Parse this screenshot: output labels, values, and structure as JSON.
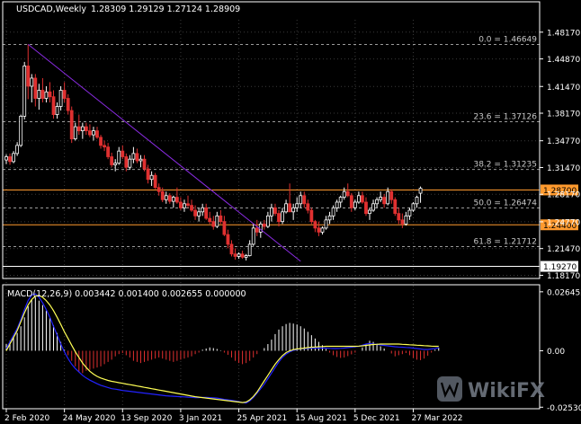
{
  "chart_data": {
    "type": "candlestick",
    "symbol_label": "USDCAD,Weekly",
    "ohlc_label": "1.28309 1.29129 1.27124 1.28909",
    "price_axis": {
      "ticks": [
        "1.48170",
        "1.44870",
        "1.41470",
        "1.38170",
        "1.34770",
        "1.31470",
        "1.28170",
        "1.24770",
        "1.21470",
        "1.18170"
      ],
      "ylim": [
        1.18,
        1.497
      ]
    },
    "date_axis": [
      "2 Feb 2020",
      "24 May 2020",
      "13 Sep 2020",
      "3 Jan 2021",
      "25 Apr 2021",
      "15 Aug 2021",
      "5 Dec 2021",
      "27 Mar 2022"
    ],
    "fibonacci": [
      {
        "label": "0.0 = 1.46649",
        "price": 1.46649
      },
      {
        "label": "23.6 = 1.37126",
        "price": 1.37126
      },
      {
        "label": "38.2 = 1.31235",
        "price": 1.31235
      },
      {
        "label": "50.0 = 1.26474",
        "price": 1.26474
      },
      {
        "label": "61.8 = 1.21712",
        "price": 1.21712
      }
    ],
    "levels": [
      {
        "label": "1.28700",
        "price": 1.287,
        "color": "#ff9a2e"
      },
      {
        "label": "1.24400",
        "price": 1.244,
        "color": "#ff9a2e"
      },
      {
        "label": "1.19270",
        "price": 1.1927,
        "color": "#ffffff"
      }
    ],
    "trendline": {
      "from": {
        "date": "16 Mar 2020",
        "price": 1.4667
      },
      "to": {
        "date": "19 Sep 2021",
        "price": 1.199
      },
      "color": "#8a2be2"
    },
    "candles": [
      [
        1.324,
        1.331,
        1.319,
        1.328
      ],
      [
        1.328,
        1.332,
        1.318,
        1.322
      ],
      [
        1.322,
        1.335,
        1.32,
        1.332
      ],
      [
        1.332,
        1.346,
        1.329,
        1.342
      ],
      [
        1.342,
        1.38,
        1.34,
        1.378
      ],
      [
        1.378,
        1.445,
        1.374,
        1.44
      ],
      [
        1.44,
        1.4667,
        1.399,
        1.415
      ],
      [
        1.415,
        1.43,
        1.395,
        1.425
      ],
      [
        1.425,
        1.43,
        1.39,
        1.4
      ],
      [
        1.4,
        1.418,
        1.386,
        1.41
      ],
      [
        1.41,
        1.425,
        1.395,
        1.4
      ],
      [
        1.4,
        1.415,
        1.395,
        1.408
      ],
      [
        1.408,
        1.42,
        1.395,
        1.402
      ],
      [
        1.402,
        1.41,
        1.375,
        1.38
      ],
      [
        1.38,
        1.395,
        1.375,
        1.39
      ],
      [
        1.39,
        1.415,
        1.385,
        1.41
      ],
      [
        1.41,
        1.42,
        1.395,
        1.4
      ],
      [
        1.4,
        1.405,
        1.38,
        1.385
      ],
      [
        1.385,
        1.39,
        1.345,
        1.35
      ],
      [
        1.35,
        1.37,
        1.348,
        1.365
      ],
      [
        1.365,
        1.38,
        1.355,
        1.36
      ],
      [
        1.36,
        1.37,
        1.35,
        1.365
      ],
      [
        1.365,
        1.37,
        1.355,
        1.36
      ],
      [
        1.36,
        1.368,
        1.352,
        1.355
      ],
      [
        1.355,
        1.365,
        1.348,
        1.36
      ],
      [
        1.36,
        1.365,
        1.35,
        1.352
      ],
      [
        1.352,
        1.355,
        1.338,
        1.342
      ],
      [
        1.342,
        1.348,
        1.335,
        1.34
      ],
      [
        1.34,
        1.345,
        1.325,
        1.328
      ],
      [
        1.328,
        1.333,
        1.315,
        1.318
      ],
      [
        1.318,
        1.325,
        1.31,
        1.32
      ],
      [
        1.32,
        1.34,
        1.318,
        1.335
      ],
      [
        1.335,
        1.342,
        1.325,
        1.328
      ],
      [
        1.328,
        1.332,
        1.31,
        1.315
      ],
      [
        1.315,
        1.33,
        1.312,
        1.325
      ],
      [
        1.325,
        1.34,
        1.32,
        1.332
      ],
      [
        1.332,
        1.338,
        1.32,
        1.323
      ],
      [
        1.323,
        1.33,
        1.315,
        1.325
      ],
      [
        1.325,
        1.33,
        1.31,
        1.313
      ],
      [
        1.313,
        1.318,
        1.295,
        1.3
      ],
      [
        1.3,
        1.31,
        1.292,
        1.305
      ],
      [
        1.305,
        1.308,
        1.288,
        1.29
      ],
      [
        1.29,
        1.295,
        1.28,
        1.285
      ],
      [
        1.285,
        1.29,
        1.272,
        1.275
      ],
      [
        1.275,
        1.285,
        1.27,
        1.28
      ],
      [
        1.28,
        1.283,
        1.27,
        1.273
      ],
      [
        1.273,
        1.28,
        1.265,
        1.278
      ],
      [
        1.278,
        1.29,
        1.27,
        1.272
      ],
      [
        1.272,
        1.278,
        1.262,
        1.265
      ],
      [
        1.265,
        1.275,
        1.26,
        1.27
      ],
      [
        1.27,
        1.28,
        1.265,
        1.268
      ],
      [
        1.268,
        1.275,
        1.26,
        1.262
      ],
      [
        1.262,
        1.268,
        1.25,
        1.255
      ],
      [
        1.255,
        1.265,
        1.248,
        1.26
      ],
      [
        1.26,
        1.27,
        1.255,
        1.265
      ],
      [
        1.265,
        1.27,
        1.25,
        1.252
      ],
      [
        1.252,
        1.26,
        1.245,
        1.248
      ],
      [
        1.248,
        1.255,
        1.238,
        1.242
      ],
      [
        1.242,
        1.26,
        1.24,
        1.255
      ],
      [
        1.255,
        1.262,
        1.245,
        1.248
      ],
      [
        1.248,
        1.255,
        1.23,
        1.232
      ],
      [
        1.232,
        1.238,
        1.215,
        1.22
      ],
      [
        1.22,
        1.225,
        1.205,
        1.208
      ],
      [
        1.208,
        1.215,
        1.201,
        1.205
      ],
      [
        1.205,
        1.21,
        1.202,
        1.208
      ],
      [
        1.208,
        1.212,
        1.202,
        1.204
      ],
      [
        1.204,
        1.208,
        1.2,
        1.206
      ],
      [
        1.206,
        1.225,
        1.205,
        1.22
      ],
      [
        1.22,
        1.245,
        1.218,
        1.24
      ],
      [
        1.24,
        1.25,
        1.23,
        1.235
      ],
      [
        1.235,
        1.248,
        1.228,
        1.245
      ],
      [
        1.245,
        1.25,
        1.238,
        1.242
      ],
      [
        1.242,
        1.26,
        1.24,
        1.255
      ],
      [
        1.255,
        1.27,
        1.248,
        1.265
      ],
      [
        1.265,
        1.27,
        1.255,
        1.258
      ],
      [
        1.258,
        1.262,
        1.242,
        1.248
      ],
      [
        1.248,
        1.265,
        1.245,
        1.26
      ],
      [
        1.26,
        1.275,
        1.258,
        1.27
      ],
      [
        1.27,
        1.295,
        1.265,
        1.26
      ],
      [
        1.26,
        1.27,
        1.25,
        1.265
      ],
      [
        1.265,
        1.278,
        1.26,
        1.27
      ],
      [
        1.27,
        1.285,
        1.265,
        1.28
      ],
      [
        1.28,
        1.285,
        1.265,
        1.27
      ],
      [
        1.27,
        1.275,
        1.258,
        1.262
      ],
      [
        1.262,
        1.265,
        1.245,
        1.248
      ],
      [
        1.248,
        1.25,
        1.235,
        1.24
      ],
      [
        1.24,
        1.248,
        1.23,
        1.235
      ],
      [
        1.235,
        1.242,
        1.232,
        1.24
      ],
      [
        1.24,
        1.255,
        1.238,
        1.25
      ],
      [
        1.25,
        1.26,
        1.245,
        1.255
      ],
      [
        1.255,
        1.268,
        1.25,
        1.265
      ],
      [
        1.265,
        1.275,
        1.26,
        1.272
      ],
      [
        1.272,
        1.28,
        1.265,
        1.278
      ],
      [
        1.278,
        1.29,
        1.275,
        1.285
      ],
      [
        1.285,
        1.295,
        1.278,
        1.28
      ],
      [
        1.28,
        1.283,
        1.26,
        1.265
      ],
      [
        1.265,
        1.275,
        1.262,
        1.272
      ],
      [
        1.272,
        1.285,
        1.27,
        1.28
      ],
      [
        1.28,
        1.285,
        1.27,
        1.272
      ],
      [
        1.272,
        1.278,
        1.255,
        1.258
      ],
      [
        1.258,
        1.265,
        1.25,
        1.262
      ],
      [
        1.262,
        1.275,
        1.26,
        1.27
      ],
      [
        1.27,
        1.278,
        1.265,
        1.275
      ],
      [
        1.275,
        1.285,
        1.272,
        1.278
      ],
      [
        1.278,
        1.282,
        1.265,
        1.27
      ],
      [
        1.27,
        1.29,
        1.268,
        1.285
      ],
      [
        1.285,
        1.288,
        1.27,
        1.275
      ],
      [
        1.275,
        1.278,
        1.255,
        1.258
      ],
      [
        1.258,
        1.265,
        1.245,
        1.25
      ],
      [
        1.25,
        1.258,
        1.24,
        1.245
      ],
      [
        1.245,
        1.26,
        1.243,
        1.255
      ],
      [
        1.255,
        1.265,
        1.25,
        1.262
      ],
      [
        1.262,
        1.272,
        1.26,
        1.27
      ],
      [
        1.27,
        1.28,
        1.265,
        1.278
      ],
      [
        1.283,
        1.2913,
        1.2712,
        1.2891
      ]
    ],
    "macd": {
      "label": "MACD(12,26,9) 0.003442 0.001400 0.002655 0.000000",
      "ticks": [
        "0.026452",
        "0.00",
        "-0.025307"
      ],
      "ylim": [
        -0.026,
        0.028
      ],
      "colors": {
        "hist_up": "#ffffff",
        "hist_down": "#e03030",
        "main": "#2222ff",
        "signal": "#ffff55"
      },
      "hist": [
        0.003,
        0.0045,
        0.006,
        0.008,
        0.011,
        0.015,
        0.02,
        0.023,
        0.024,
        0.0225,
        0.0205,
        0.018,
        0.015,
        0.0115,
        0.008,
        0.004,
        0.0005,
        -0.002,
        -0.0045,
        -0.007,
        -0.0095,
        -0.01,
        -0.009,
        -0.0085,
        -0.008,
        -0.0075,
        -0.007,
        -0.006,
        -0.005,
        -0.004,
        -0.0025,
        -0.0015,
        -0.001,
        -0.002,
        -0.003,
        -0.0045,
        -0.005,
        -0.0055,
        -0.005,
        -0.0045,
        -0.004,
        -0.0035,
        -0.003,
        -0.0035,
        -0.004,
        -0.0045,
        -0.005,
        -0.0045,
        -0.004,
        -0.0035,
        -0.003,
        -0.0025,
        -0.0015,
        -0.0008,
        0.0005,
        0.001,
        0.0015,
        0.0012,
        0.0008,
        0.0002,
        -0.0008,
        -0.0018,
        -0.003,
        -0.0045,
        -0.0055,
        -0.006,
        -0.0055,
        -0.0045,
        -0.003,
        -0.0015,
        0.0,
        0.0012,
        0.003,
        0.005,
        0.0075,
        0.0095,
        0.011,
        0.012,
        0.0125,
        0.0122,
        0.0118,
        0.011,
        0.01,
        0.0085,
        0.007,
        0.0055,
        0.004,
        0.0025,
        0.0008,
        -0.0008,
        -0.002,
        -0.0028,
        -0.0032,
        -0.003,
        -0.0024,
        -0.0016,
        -0.0008,
        0.0,
        0.0015,
        0.003,
        0.0045,
        0.004,
        0.0032,
        0.002,
        0.001,
        0.0,
        -0.0012,
        -0.0025,
        -0.002,
        -0.0015,
        -0.001,
        -0.002,
        -0.0032,
        -0.004,
        -0.0042,
        -0.0035,
        -0.0022,
        -0.0008,
        0.0005,
        0.0014
      ],
      "main": [
        0.001,
        0.004,
        0.007,
        0.01,
        0.014,
        0.0185,
        0.0225,
        0.025,
        0.0255,
        0.024,
        0.0215,
        0.0185,
        0.015,
        0.011,
        0.007,
        0.003,
        -0.0005,
        -0.0035,
        -0.006,
        -0.008,
        -0.0095,
        -0.011,
        -0.0122,
        -0.0132,
        -0.014,
        -0.0148,
        -0.0155,
        -0.016,
        -0.0165,
        -0.017,
        -0.0172,
        -0.0175,
        -0.0178,
        -0.018,
        -0.0182,
        -0.0184,
        -0.0186,
        -0.0188,
        -0.019,
        -0.0192,
        -0.0194,
        -0.0196,
        -0.0198,
        -0.02,
        -0.0202,
        -0.0203,
        -0.0204,
        -0.0205,
        -0.0206,
        -0.0207,
        -0.0208,
        -0.0209,
        -0.021,
        -0.021,
        -0.0209,
        -0.0209,
        -0.021,
        -0.0211,
        -0.0212,
        -0.0215,
        -0.0218,
        -0.022,
        -0.0222,
        -0.0225,
        -0.0228,
        -0.0232,
        -0.0235,
        -0.0225,
        -0.021,
        -0.019,
        -0.017,
        -0.015,
        -0.0125,
        -0.01,
        -0.0075,
        -0.005,
        -0.003,
        -0.0015,
        -0.0005,
        0.0002,
        0.0006,
        0.0009,
        0.001,
        0.0011,
        0.0012,
        0.0012,
        0.0012,
        0.0012,
        0.0012,
        0.0011,
        0.001,
        0.001,
        0.0011,
        0.0012,
        0.0014,
        0.0016,
        0.0018,
        0.002,
        0.0025,
        0.003,
        0.0032,
        0.003,
        0.0028,
        0.0026,
        0.0024,
        0.0022,
        0.002,
        0.0018,
        0.0017,
        0.0016,
        0.0015,
        0.0014,
        0.0012,
        0.001,
        0.0008,
        0.0006,
        0.0006,
        0.0008,
        0.001,
        0.0014
      ],
      "signal": [
        0.0,
        0.003,
        0.006,
        0.009,
        0.013,
        0.017,
        0.0205,
        0.023,
        0.0245,
        0.0248,
        0.024,
        0.0225,
        0.0205,
        0.018,
        0.015,
        0.0118,
        0.0085,
        0.0055,
        0.0025,
        -0.0005,
        -0.003,
        -0.0055,
        -0.0075,
        -0.0092,
        -0.0105,
        -0.0115,
        -0.0122,
        -0.0128,
        -0.0133,
        -0.0137,
        -0.014,
        -0.0143,
        -0.0146,
        -0.0149,
        -0.0152,
        -0.0155,
        -0.0158,
        -0.0161,
        -0.0164,
        -0.0167,
        -0.017,
        -0.0173,
        -0.0176,
        -0.0179,
        -0.0182,
        -0.0185,
        -0.0188,
        -0.0191,
        -0.0194,
        -0.0197,
        -0.02,
        -0.0203,
        -0.0206,
        -0.0208,
        -0.021,
        -0.0212,
        -0.0214,
        -0.0216,
        -0.0218,
        -0.022,
        -0.0222,
        -0.0224,
        -0.0226,
        -0.0228,
        -0.023,
        -0.0232,
        -0.023,
        -0.022,
        -0.0205,
        -0.0185,
        -0.016,
        -0.0135,
        -0.011,
        -0.0085,
        -0.006,
        -0.004,
        -0.0022,
        -0.0008,
        0.0,
        0.0005,
        0.0008,
        0.001,
        0.0012,
        0.0014,
        0.0016,
        0.0017,
        0.0018,
        0.0019,
        0.002,
        0.002,
        0.002,
        0.002,
        0.002,
        0.002,
        0.002,
        0.002,
        0.002,
        0.0021,
        0.0022,
        0.0024,
        0.0026,
        0.0028,
        0.0029,
        0.003,
        0.003,
        0.003,
        0.003,
        0.003,
        0.003,
        0.0029,
        0.0028,
        0.0027,
        0.0026,
        0.0025,
        0.0024,
        0.0023,
        0.0022,
        0.0021,
        0.002,
        0.002
      ]
    },
    "colors": {
      "background": "#000000",
      "bull": "#ffffff",
      "bear": "#e03030",
      "grid": "#606060",
      "fib": "#9a9a9a",
      "axis": "#ffffff"
    },
    "watermark": "WikiFX"
  }
}
